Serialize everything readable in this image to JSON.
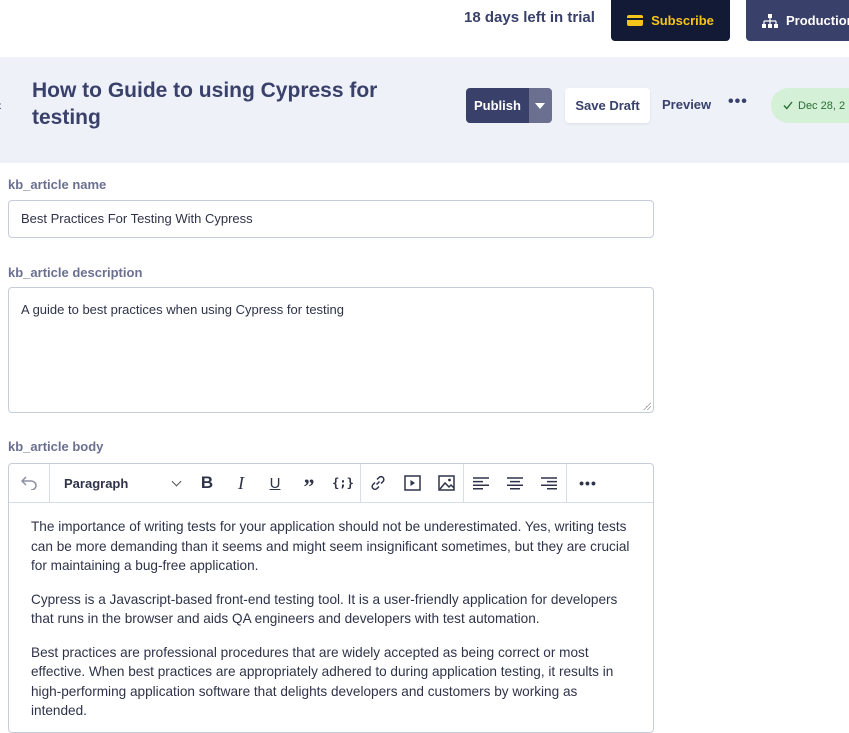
{
  "topbar": {
    "trial_text": "18 days left in trial",
    "subscribe_label": "Subscribe",
    "production_label": "Production"
  },
  "header": {
    "title": "How to Guide to using Cypress for testing",
    "publish_label": "Publish",
    "save_draft_label": "Save Draft",
    "preview_label": "Preview",
    "status_text": "Dec 28, 2"
  },
  "form": {
    "name_label": "kb_article name",
    "name_value": "Best Practices For Testing With Cypress",
    "description_label": "kb_article description",
    "description_value": "A guide to best practices when using Cypress for testing",
    "body_label": "kb_article body"
  },
  "editor": {
    "block_format": "Paragraph",
    "paragraphs": [
      "The importance of writing tests for your application should not be underestimated. Yes, writing tests can be more demanding than it seems and might seem insignificant sometimes, but they are crucial for maintaining a bug-free application.",
      "Cypress is a Javascript-based front-end testing tool. It is a user-friendly application for developers that runs in the browser and aids QA engineers and developers with test automation.",
      "Best practices are professional procedures that are widely accepted as being correct or most effective. When best practices are appropriately adhered to during application testing, it results in high-performing application software that delights developers and customers by working as intended."
    ]
  },
  "colors": {
    "brand_dark": "#131a35",
    "brand": "#39406a",
    "accent_yellow": "#f5c518",
    "status_green_bg": "#d4f0d6"
  }
}
